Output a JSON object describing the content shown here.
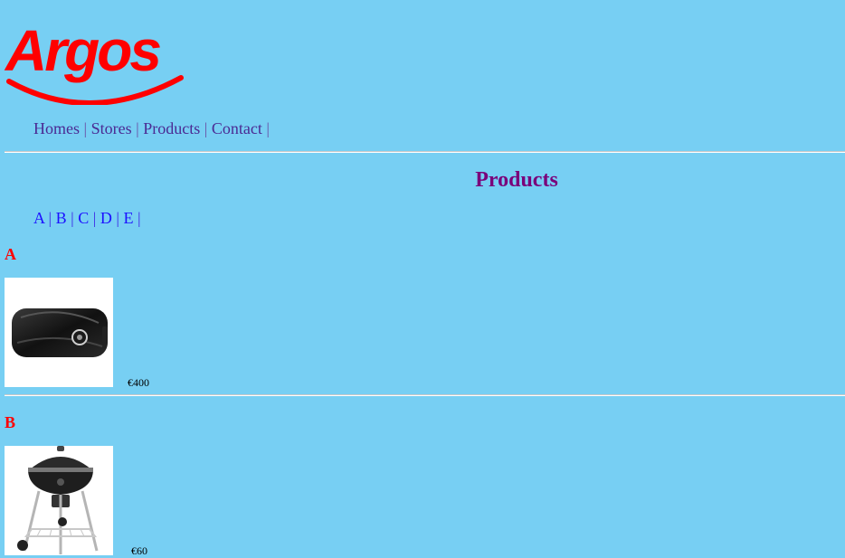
{
  "brand": {
    "logo_text": "Argos",
    "color": "#ff0000"
  },
  "nav": {
    "items": [
      {
        "label": "Homes",
        "sep": "|"
      },
      {
        "label": "Stores",
        "sep": "|"
      },
      {
        "label": "Products",
        "sep": "|"
      },
      {
        "label": "Contact",
        "sep": "|"
      }
    ]
  },
  "page": {
    "title": "Products",
    "background": "#77cff3"
  },
  "letter_index": {
    "items": [
      {
        "label": "A",
        "sep": "|"
      },
      {
        "label": "B",
        "sep": "|"
      },
      {
        "label": "C",
        "sep": "|"
      },
      {
        "label": "D",
        "sep": "|"
      },
      {
        "label": "E",
        "sep": "|"
      }
    ]
  },
  "sections": [
    {
      "letter": "A",
      "product": {
        "image_icon": "projector-image",
        "price": "€400"
      }
    },
    {
      "letter": "B",
      "product": {
        "image_icon": "bbq-grill-image",
        "price": "€60"
      }
    }
  ]
}
